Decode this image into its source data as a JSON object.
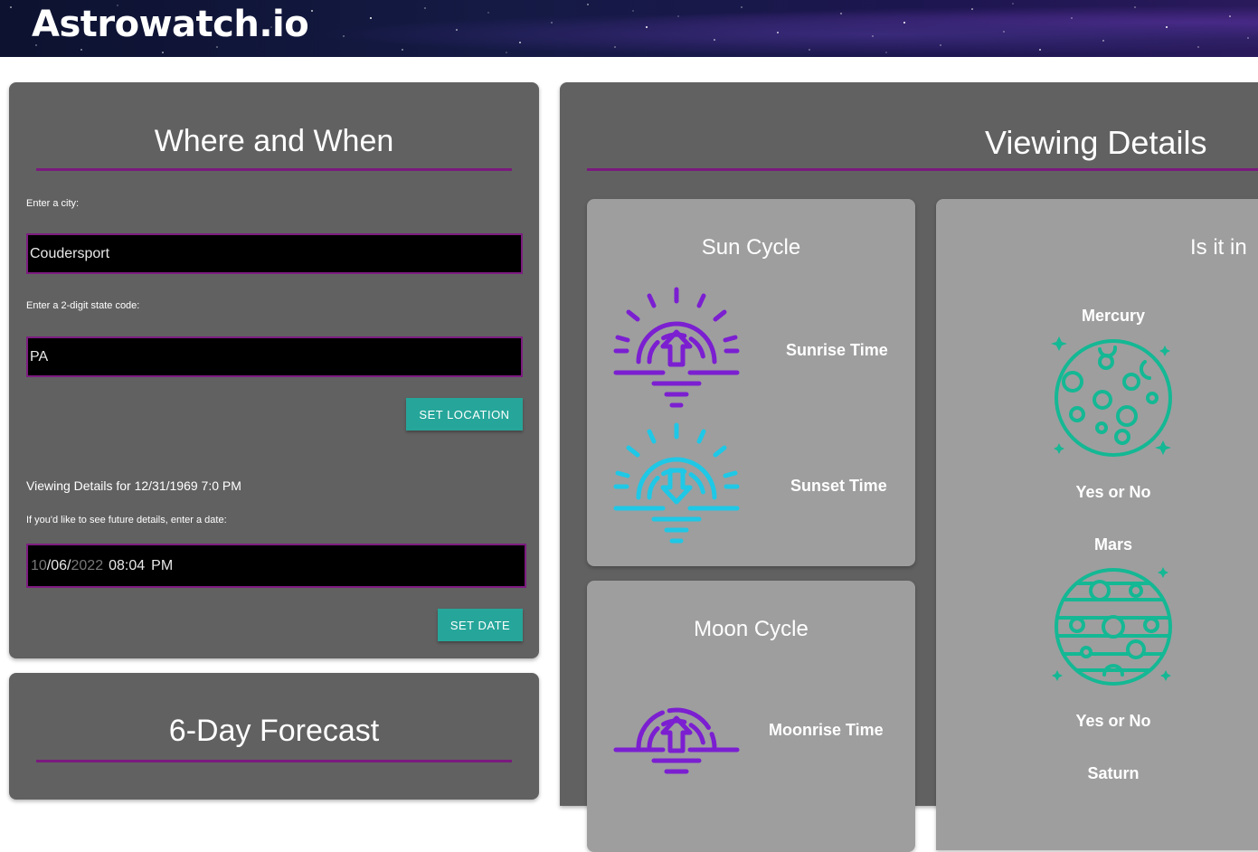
{
  "header": {
    "title": "Astrowatch.io"
  },
  "where_when": {
    "title": "Where and When",
    "city_label": "Enter a city:",
    "city_value": "Coudersport",
    "state_label": "Enter a 2-digit state code:",
    "state_value": "PA",
    "set_location_label": "SET LOCATION",
    "viewing_details_text": "Viewing Details for 12/31/1969 7:0 PM",
    "future_label": "If you'd like to see future details, enter a date:",
    "date_month": "10",
    "date_day": "06",
    "date_year": "2022",
    "date_time": "08:04",
    "date_ampm": "PM",
    "set_date_label": "SET DATE"
  },
  "forecast": {
    "title": "6-Day Forecast"
  },
  "viewing": {
    "title": "Viewing Details",
    "sun_cycle": {
      "title": "Sun Cycle",
      "sunrise_label": "Sunrise Time",
      "sunset_label": "Sunset Time"
    },
    "moon_cycle": {
      "title": "Moon Cycle",
      "moonrise_label": "Moonrise Time"
    },
    "planets": {
      "title": "Is it in",
      "items": [
        {
          "name": "Mercury",
          "status": "Yes or No",
          "icon": "mercury-icon"
        },
        {
          "name": "Mars",
          "status": "Yes or No",
          "icon": "mars-icon"
        },
        {
          "name": "Saturn",
          "icon": "saturn-icon"
        }
      ]
    }
  },
  "colors": {
    "accent_purple": "#7a1a7e",
    "button_teal": "#26a69a",
    "sunrise_icon": "#7b1fd1",
    "sunset_icon": "#1ec8e6",
    "planet_icon": "#14b894",
    "card_dark": "#616161",
    "card_light": "#9e9e9e"
  }
}
